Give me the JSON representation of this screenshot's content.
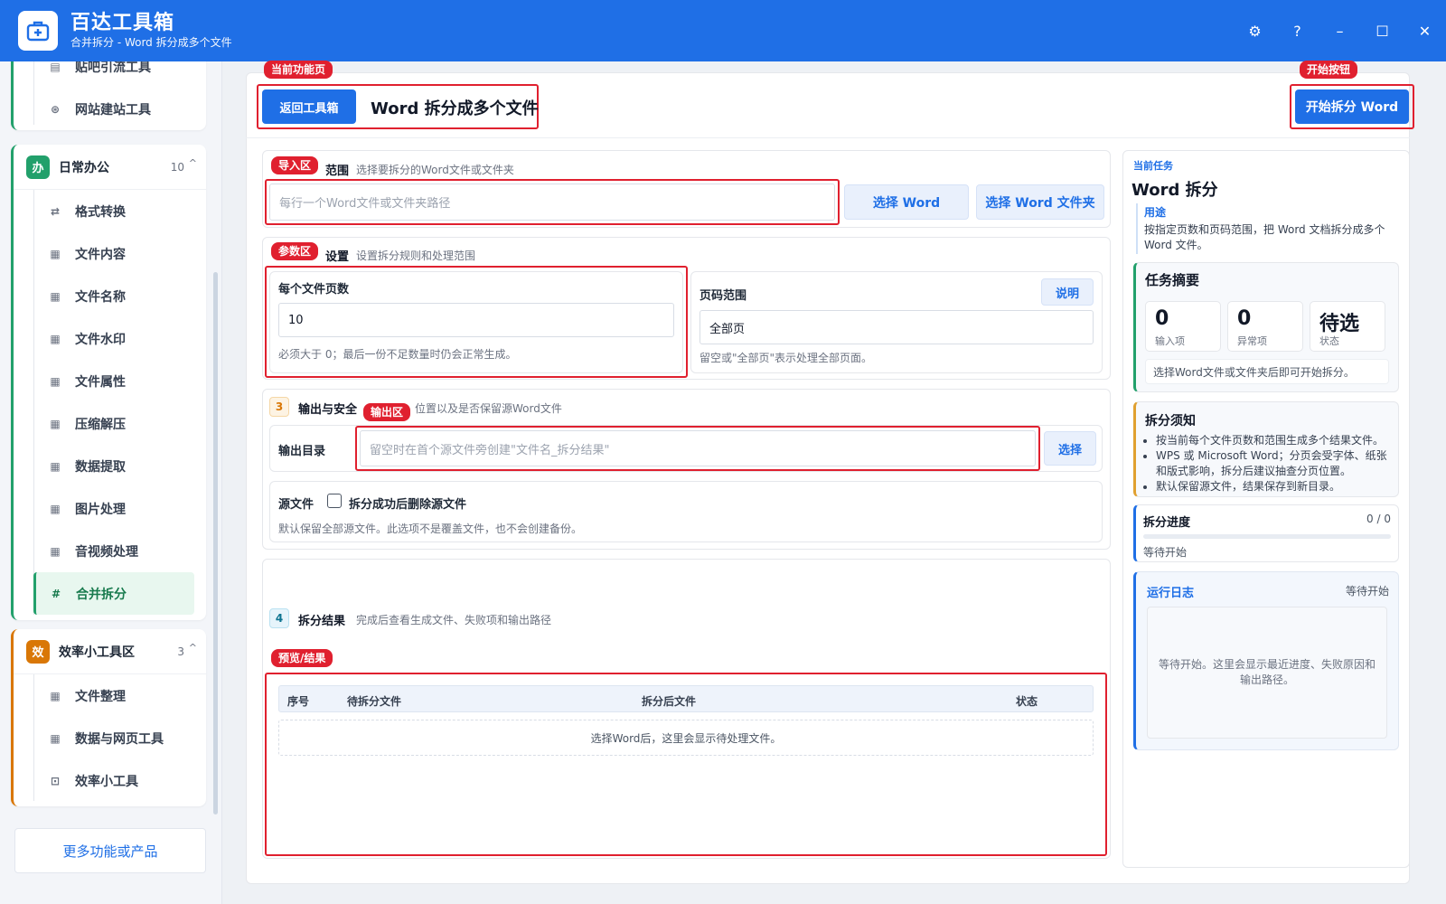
{
  "app": {
    "title": "百达工具箱",
    "subtitle": "合并拆分 - Word 拆分成多个文件",
    "controls": [
      "⚙",
      "?",
      "–",
      "☐",
      "✕"
    ]
  },
  "sidebar": {
    "top_items": [
      {
        "icon": "doc-icon",
        "label": "贴吧引流工具"
      },
      {
        "icon": "globe-icon",
        "label": "网站建站工具"
      }
    ],
    "groups": [
      {
        "badge": "办",
        "name": "日常办公",
        "count": "10",
        "color": "#22a06b",
        "items": [
          {
            "icon": "swap-icon",
            "label": "格式转换"
          },
          {
            "icon": "grid-icon",
            "label": "文件内容"
          },
          {
            "icon": "grid-icon",
            "label": "文件名称"
          },
          {
            "icon": "grid-icon",
            "label": "文件水印"
          },
          {
            "icon": "grid-icon",
            "label": "文件属性"
          },
          {
            "icon": "grid-icon",
            "label": "压缩解压"
          },
          {
            "icon": "grid-icon",
            "label": "数据提取"
          },
          {
            "icon": "grid-icon",
            "label": "图片处理"
          },
          {
            "icon": "grid-icon",
            "label": "音视频处理"
          },
          {
            "icon": "hash-icon",
            "label": "合并拆分",
            "active": true
          }
        ]
      },
      {
        "badge": "效",
        "name": "效率小工具区",
        "count": "3",
        "color": "#d97706",
        "items": [
          {
            "icon": "grid-icon",
            "label": "文件整理"
          },
          {
            "icon": "grid-icon",
            "label": "数据与网页工具"
          },
          {
            "icon": "box-icon",
            "label": "效率小工具"
          }
        ]
      }
    ],
    "more": "更多功能或产品"
  },
  "annotations": {
    "current_page": "当前功能页",
    "start_button": "开始按钮",
    "import": "导入区",
    "params": "参数区",
    "output": "输出区",
    "preview": "预览/结果"
  },
  "header": {
    "back": "返回工具箱",
    "title": "Word 拆分成多个文件",
    "start": "开始拆分 Word"
  },
  "section1": {
    "title": "范围",
    "desc": "选择要拆分的Word文件或文件夹",
    "placeholder": "每行一个Word文件或文件夹路径",
    "btn_file": "选择 Word",
    "btn_folder": "选择 Word 文件夹"
  },
  "section2": {
    "title": "设置",
    "desc": "设置拆分规则和处理范围",
    "pages_label": "每个文件页数",
    "pages_value": "10",
    "pages_hint": "必须大于 0；最后一份不足数量时仍会正常生成。",
    "range_label": "页码范围",
    "range_help": "说明",
    "range_value": "全部页",
    "range_hint": "留空或\"全部页\"表示处理全部页面。"
  },
  "section3": {
    "num": "3",
    "title": "输出与安全",
    "desc": "位置以及是否保留源Word文件",
    "dir_label": "输出目录",
    "dir_placeholder": "留空时在首个源文件旁创建\"文件名_拆分结果\"",
    "dir_btn": "选择",
    "src_label": "源文件",
    "src_checkbox": "拆分成功后删除源文件",
    "src_hint": "默认保留全部源文件。此选项不是覆盖文件，也不会创建备份。"
  },
  "section4": {
    "num": "4",
    "title": "拆分结果",
    "desc": "完成后查看生成文件、失败项和输出路径",
    "columns": [
      "序号",
      "待拆分文件",
      "拆分后文件",
      "状态"
    ],
    "empty": "选择Word后，这里会显示待处理文件。"
  },
  "right": {
    "task_tag": "当前任务",
    "task_name": "Word 拆分",
    "usage_label": "用途",
    "usage_text": "按指定页数和页码范围，把 Word 文档拆分成多个 Word 文件。",
    "summary_title": "任务摘要",
    "stats": [
      {
        "value": "0",
        "label": "输入项"
      },
      {
        "value": "0",
        "label": "异常项"
      },
      {
        "value": "待选",
        "label": "状态"
      }
    ],
    "summary_hint": "选择Word文件或文件夹后即可开始拆分。",
    "notes_title": "拆分须知",
    "notes": [
      "按当前每个文件页数和范围生成多个结果文件。",
      "WPS 或 Microsoft Word；分页会受字体、纸张和版式影响，拆分后建议抽查分页位置。",
      "默认保留源文件，结果保存到新目录。"
    ],
    "progress_title": "拆分进度",
    "progress_count": "0 / 0",
    "progress_value": 0,
    "progress_status": "等待开始",
    "log_title": "运行日志",
    "log_status": "等待开始",
    "log_empty": "等待开始。这里会显示最近进度、失败原因和输出路径。"
  },
  "colors": {
    "primary": "#1f6fe6",
    "annotation": "#e0202f",
    "green": "#22a06b",
    "orange": "#d97706"
  }
}
